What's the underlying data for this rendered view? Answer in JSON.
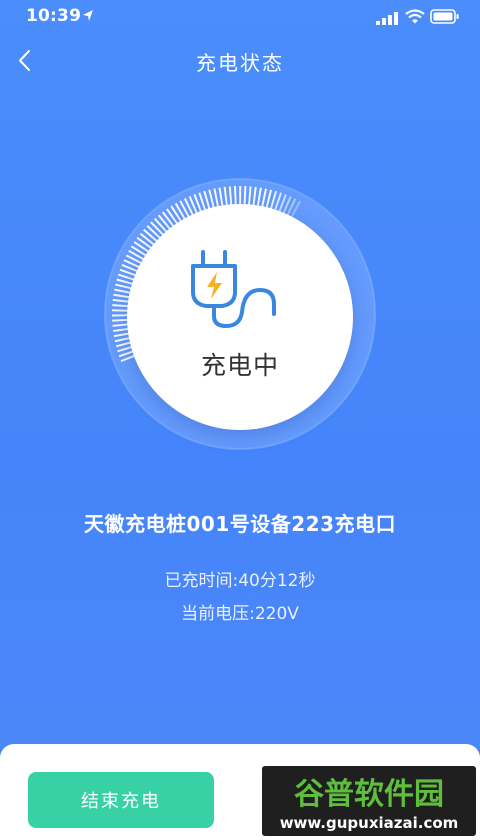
{
  "status_bar": {
    "time": "10:39",
    "icons": [
      "location-arrow-icon",
      "signal-icon",
      "wifi-icon",
      "battery-icon"
    ]
  },
  "nav": {
    "back_icon": "chevron-left-icon",
    "title": "充电状态"
  },
  "gauge": {
    "status": "充电中",
    "icon": "plug-icon",
    "progress_fraction": 0.36,
    "colors": {
      "track": "#6aa2fc",
      "filled_tick": "#ffffff",
      "inner": "#ffffff",
      "plug": "#3a87e0",
      "bolt": "#f3b324"
    }
  },
  "info": {
    "device_name": "天徽充电桩001号设备223充电口",
    "elapsed": "已充时间:40分12秒",
    "voltage": "当前电压:220V"
  },
  "actions": {
    "end_label": "结束充电"
  },
  "watermark": {
    "title": "谷普软件园",
    "url": "www.gupuxiazai.com"
  },
  "colors": {
    "background": "#4a8dfb",
    "button": "#38d1a6"
  }
}
